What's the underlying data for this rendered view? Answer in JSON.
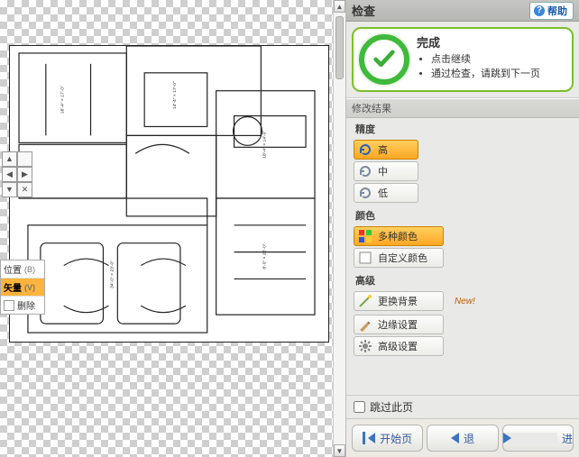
{
  "header": {
    "title": "检查",
    "help_label": "帮助"
  },
  "status": {
    "title": "完成",
    "bullets": [
      "点击继续",
      "通过检查，请跳到下一页"
    ]
  },
  "results_group_label": "修改结果",
  "precision": {
    "label": "精度",
    "high": "高",
    "mid": "中",
    "low": "低"
  },
  "color": {
    "label": "颜色",
    "multi": "多种颜色",
    "custom": "自定义颜色"
  },
  "advanced": {
    "label": "高级",
    "change_bg": "更换背景",
    "new_tag": "New!",
    "edge": "边缘设置",
    "advanced_btn": "高级设置"
  },
  "footer_checkbox": "跳过此页",
  "nav": {
    "first": "开始页",
    "back": "退",
    "next": "进"
  },
  "palette": {
    "row1_label": "位置",
    "row1_key": "(B)",
    "row2_label": "矢量",
    "row2_key": "(V)",
    "row3_label": "删除"
  },
  "rooms": [
    "16'-4\" x 17'-0\"  4,90 x 5,20",
    "12'-4\" x 8'-0\"  2,80 x 2,60",
    "14'-4\" x 17'-0\"  4,30 x 5,20",
    "18'-4\" x 14'-0\"  5,50 x 4,10",
    "34'-0\" x 23'-0\"/23'-0\"  7,30 x 6,90/6,90/7,0",
    "8'-0\" x 22'-0\"  5,50 x 6,60",
    "19' x 23'-0\"  5,60 x 6,60"
  ]
}
